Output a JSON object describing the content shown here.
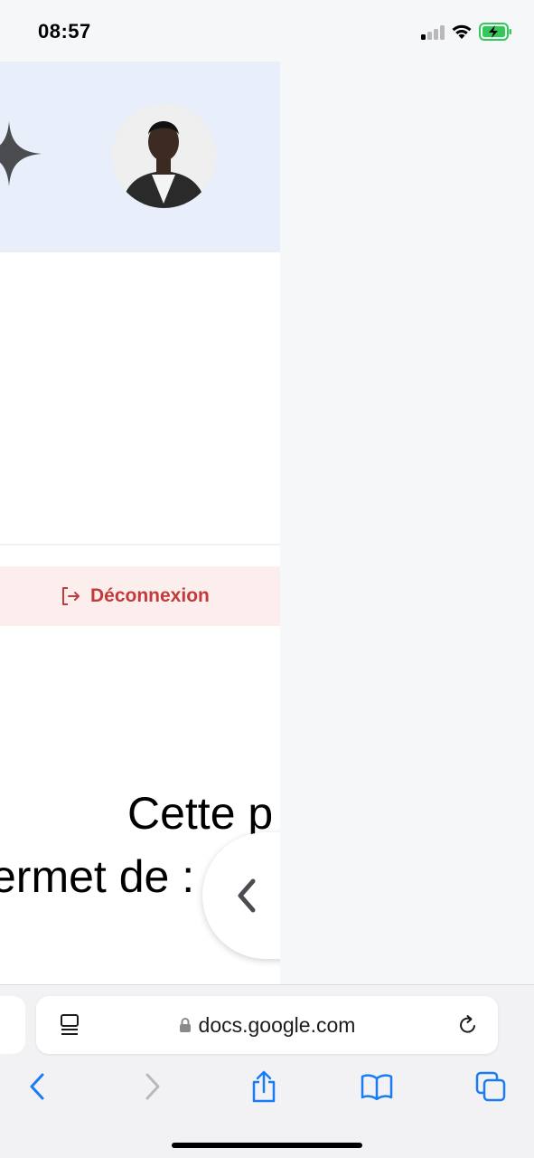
{
  "status_bar": {
    "time": "08:57",
    "signal_icon": "cellular-signal-icon",
    "wifi_icon": "wifi-icon",
    "battery_icon": "battery-charging-icon",
    "battery_color": "#34c759"
  },
  "web_page": {
    "header": {
      "background": "#e8effa",
      "sparkle_icon": "sparkle-icon",
      "avatar": "profile-avatar"
    },
    "logout": {
      "label": "Déconnexion",
      "icon": "logout-icon",
      "color": "#c23a3a",
      "background": "#fdeeee"
    },
    "document_text": {
      "line1": "Cette p",
      "line2": "ermet de :"
    },
    "back_button_icon": "chevron-left-icon"
  },
  "browser": {
    "url": "docs.google.com",
    "reader_icon": "reader-mode-icon",
    "lock_icon": "lock-icon",
    "reload_icon": "reload-icon",
    "toolbar": {
      "back_icon": "back-arrow-icon",
      "forward_icon": "forward-arrow-icon",
      "share_icon": "share-icon",
      "bookmarks_icon": "bookmarks-icon",
      "tabs_icon": "tabs-icon"
    },
    "accent_color": "#1a7cf5"
  }
}
